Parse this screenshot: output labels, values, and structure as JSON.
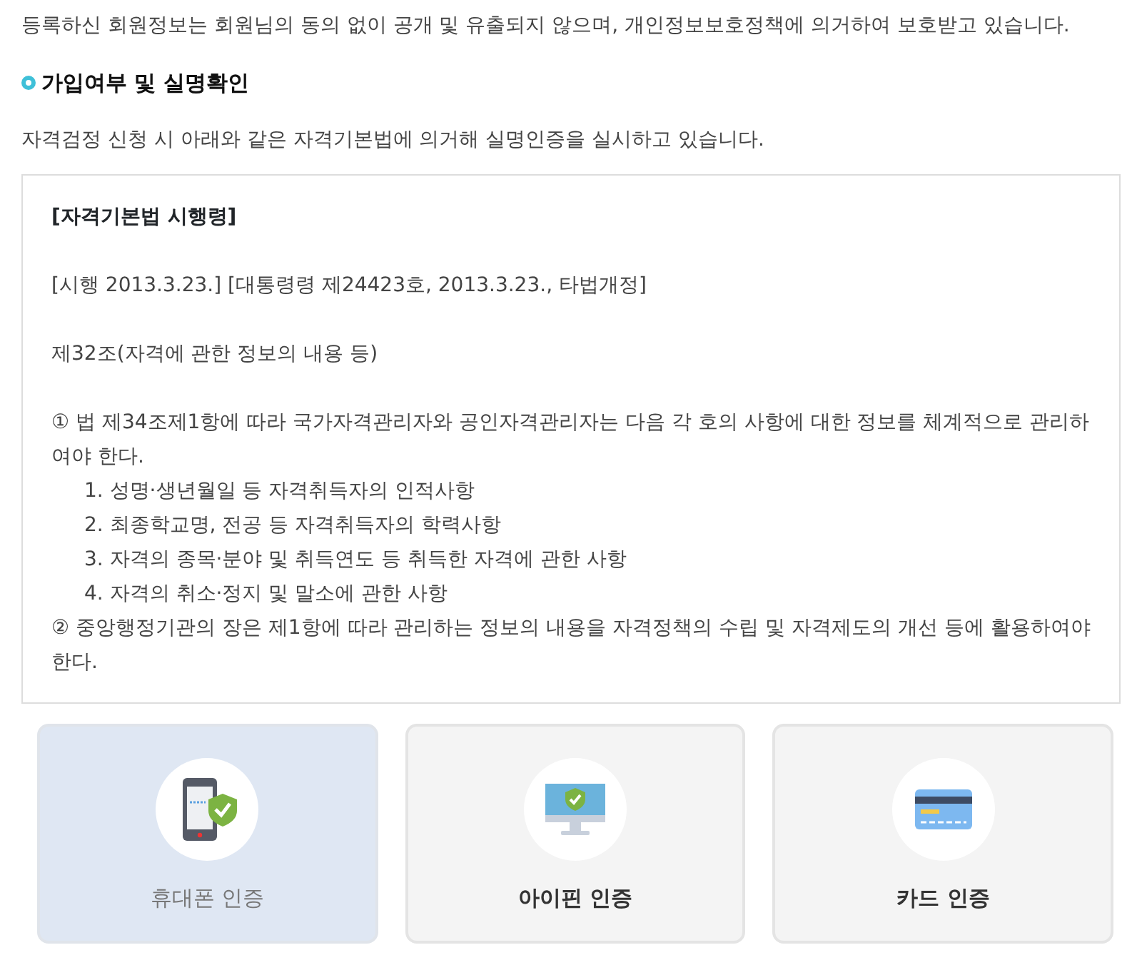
{
  "notice": "등록하신 회원정보는 회원님의 동의 없이 공개 및 유출되지 않으며, 개인정보보호정책에 의거하여 보호받고 있습니다.",
  "section": {
    "title": "가입여부 및 실명확인",
    "description": "자격검정 신청 시 아래와 같은 자격기본법에 의거해 실명인증을 실시하고 있습니다."
  },
  "law_box": {
    "title": "[자격기본법 시행령]",
    "enforcement": "[시행 2013.3.23.] [대통령령 제24423호, 2013.3.23., 타법개정]",
    "article": "제32조(자격에 관한 정보의 내용 등)",
    "paragraphs": [
      {
        "text": "① 법 제34조제1항에 따라 국가자격관리자와 공인자격관리자는 다음 각 호의 사항에 대한 정보를 체계적으로 관리하여야 한다.",
        "items": [
          "1. 성명·생년월일 등 자격취득자의 인적사항",
          "2. 최종학교명, 전공 등 자격취득자의 학력사항",
          "3. 자격의 종목·분야 및 취득연도 등 취득한 자격에 관한 사항",
          "4. 자격의 취소·정지 및 말소에 관한 사항"
        ]
      },
      {
        "text": "② 중앙행정기관의 장은 제1항에 따라 관리하는 정보의 내용을 자격정책의 수립 및 자격제도의 개선 등에 활용하여야 한다."
      }
    ]
  },
  "auth_options": [
    {
      "kind": "phone",
      "label": "휴대폰 인증",
      "selected": true
    },
    {
      "kind": "ipin",
      "label": "아이핀 인증",
      "selected": false
    },
    {
      "kind": "card",
      "label": "카드 인증",
      "selected": false
    }
  ]
}
